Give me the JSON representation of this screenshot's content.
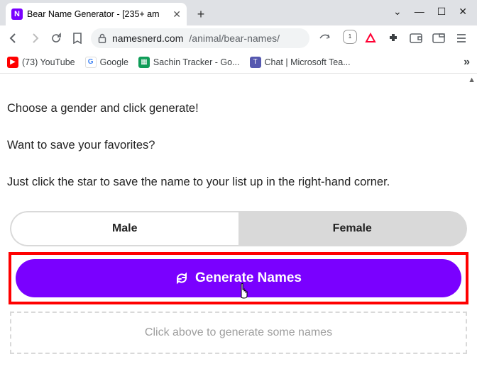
{
  "browser": {
    "tab_title": "Bear Name Generator - [235+ am",
    "url_host": "namesnerd.com",
    "url_path": "/animal/bear-names/",
    "win_dropdown": "⌄",
    "win_min": "—",
    "win_max": "☐",
    "win_close": "✕",
    "newtab": "+",
    "tab_close": "✕"
  },
  "bookmarks": {
    "youtube": "(73) YouTube",
    "google": "Google",
    "sheets": "Sachin Tracker - Go...",
    "teams": "Chat | Microsoft Tea...",
    "more": "»"
  },
  "page": {
    "intro1": "Choose a gender and click generate!",
    "intro2": "Want to save your favorites?",
    "intro3": "Just click the star to save the name to your list up in the right-hand corner.",
    "male_label": "Male",
    "female_label": "Female",
    "generate_label": "Generate Names",
    "placeholder": "Click above to generate some names"
  }
}
